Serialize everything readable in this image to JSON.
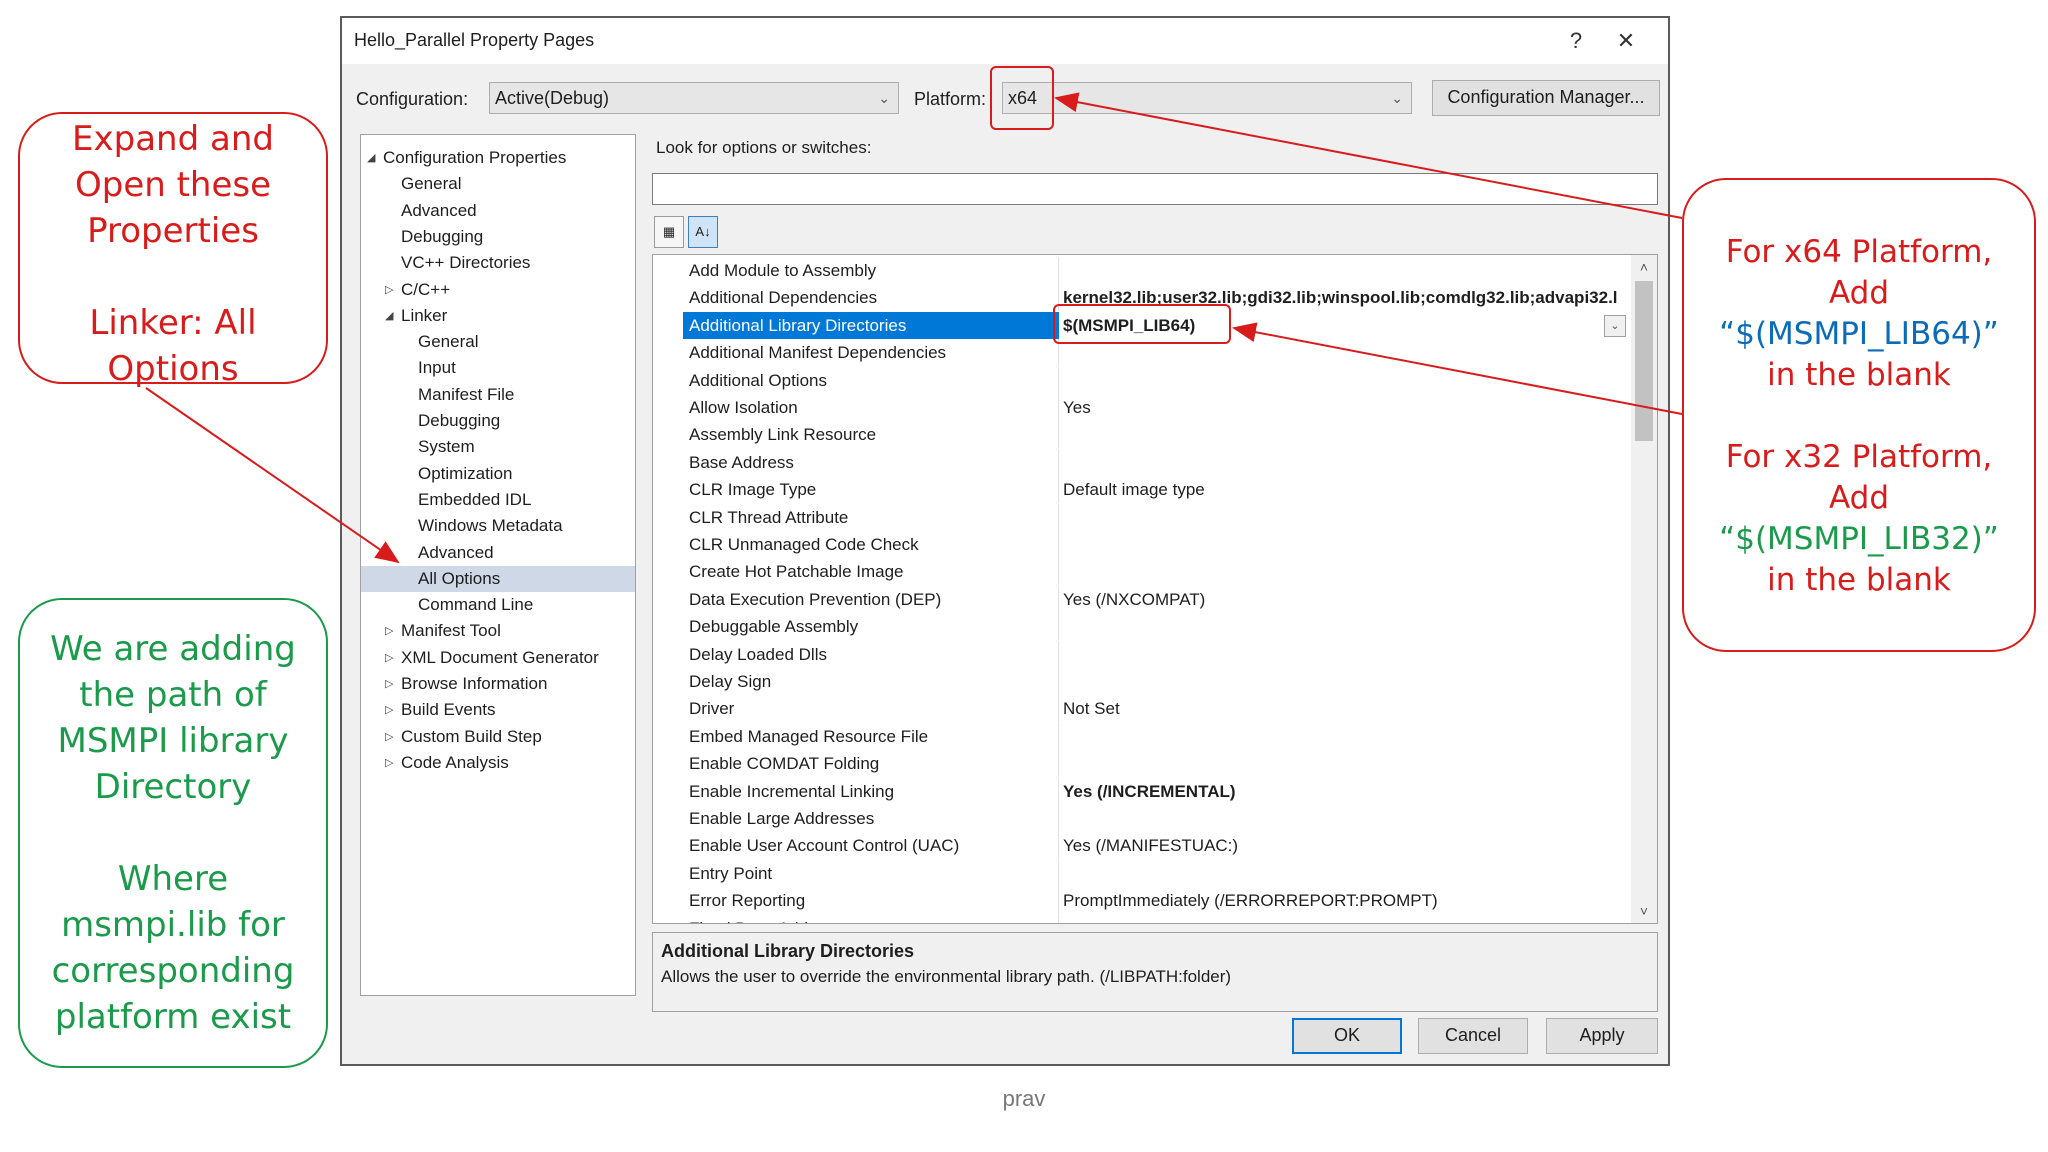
{
  "dialog": {
    "title": "Hello_Parallel Property Pages",
    "help_glyph": "?",
    "close_glyph": "✕",
    "configuration_label": "Configuration:",
    "configuration_value": "Active(Debug)",
    "platform_label": "Platform:",
    "platform_value": "x64",
    "configuration_manager_label": "Configuration Manager...",
    "search_label": "Look for options or switches:",
    "search_value": ""
  },
  "tree": [
    {
      "label": "Configuration Properties",
      "level": 0,
      "expander": "expanded"
    },
    {
      "label": "General",
      "level": 1,
      "expander": "none"
    },
    {
      "label": "Advanced",
      "level": 1,
      "expander": "none"
    },
    {
      "label": "Debugging",
      "level": 1,
      "expander": "none"
    },
    {
      "label": "VC++ Directories",
      "level": 1,
      "expander": "none"
    },
    {
      "label": "C/C++",
      "level": 1,
      "expander": "collapsed"
    },
    {
      "label": "Linker",
      "level": 1,
      "expander": "expanded"
    },
    {
      "label": "General",
      "level": 2,
      "expander": "none"
    },
    {
      "label": "Input",
      "level": 2,
      "expander": "none"
    },
    {
      "label": "Manifest File",
      "level": 2,
      "expander": "none"
    },
    {
      "label": "Debugging",
      "level": 2,
      "expander": "none"
    },
    {
      "label": "System",
      "level": 2,
      "expander": "none"
    },
    {
      "label": "Optimization",
      "level": 2,
      "expander": "none"
    },
    {
      "label": "Embedded IDL",
      "level": 2,
      "expander": "none"
    },
    {
      "label": "Windows Metadata",
      "level": 2,
      "expander": "none"
    },
    {
      "label": "Advanced",
      "level": 2,
      "expander": "none"
    },
    {
      "label": "All Options",
      "level": 2,
      "expander": "none",
      "selected": true
    },
    {
      "label": "Command Line",
      "level": 2,
      "expander": "none"
    },
    {
      "label": "Manifest Tool",
      "level": 1,
      "expander": "collapsed"
    },
    {
      "label": "XML Document Generator",
      "level": 1,
      "expander": "collapsed"
    },
    {
      "label": "Browse Information",
      "level": 1,
      "expander": "collapsed"
    },
    {
      "label": "Build Events",
      "level": 1,
      "expander": "collapsed"
    },
    {
      "label": "Custom Build Step",
      "level": 1,
      "expander": "collapsed"
    },
    {
      "label": "Code Analysis",
      "level": 1,
      "expander": "collapsed"
    }
  ],
  "grid": [
    {
      "name": "Add Module to Assembly",
      "value": ""
    },
    {
      "name": "Additional Dependencies",
      "value": "kernel32.lib;user32.lib;gdi32.lib;winspool.lib;comdlg32.lib;advapi32.l",
      "bold": true
    },
    {
      "name": "Additional Library Directories",
      "value": "$(MSMPI_LIB64)",
      "bold": true,
      "selected": true
    },
    {
      "name": "Additional Manifest Dependencies",
      "value": ""
    },
    {
      "name": "Additional Options",
      "value": ""
    },
    {
      "name": "Allow Isolation",
      "value": "Yes"
    },
    {
      "name": "Assembly Link Resource",
      "value": ""
    },
    {
      "name": "Base Address",
      "value": ""
    },
    {
      "name": "CLR Image Type",
      "value": "Default image type"
    },
    {
      "name": "CLR Thread Attribute",
      "value": ""
    },
    {
      "name": "CLR Unmanaged Code Check",
      "value": ""
    },
    {
      "name": "Create Hot Patchable Image",
      "value": ""
    },
    {
      "name": "Data Execution Prevention (DEP)",
      "value": "Yes (/NXCOMPAT)"
    },
    {
      "name": "Debuggable Assembly",
      "value": ""
    },
    {
      "name": "Delay Loaded Dlls",
      "value": ""
    },
    {
      "name": "Delay Sign",
      "value": ""
    },
    {
      "name": "Driver",
      "value": "Not Set"
    },
    {
      "name": "Embed Managed Resource File",
      "value": ""
    },
    {
      "name": "Enable COMDAT Folding",
      "value": ""
    },
    {
      "name": "Enable Incremental Linking",
      "value": "Yes (/INCREMENTAL)",
      "bold": true
    },
    {
      "name": "Enable Large Addresses",
      "value": ""
    },
    {
      "name": "Enable User Account Control (UAC)",
      "value": "Yes (/MANIFESTUAC:)"
    },
    {
      "name": "Entry Point",
      "value": ""
    },
    {
      "name": "Error Reporting",
      "value": "PromptImmediately (/ERRORREPORT:PROMPT)"
    },
    {
      "name": "Fixed Base Address",
      "value": ""
    }
  ],
  "description": {
    "title": "Additional Library Directories",
    "text": "Allows the user to override the environmental library path. (/LIBPATH:folder)"
  },
  "buttons": {
    "ok": "OK",
    "cancel": "Cancel",
    "apply": "Apply"
  },
  "callouts": {
    "expand": [
      "Expand and",
      "Open these",
      "Properties",
      "",
      "Linker: All",
      "Options"
    ],
    "adding": [
      "We are adding",
      "the path of",
      "MSMPI library",
      "Directory",
      "",
      "Where",
      "msmpi.lib for",
      "corresponding",
      "platform exist"
    ],
    "platform_x64": [
      "For x64 Platform,",
      "Add",
      "“$(MSMPI_LIB64)”",
      "in the blank"
    ],
    "platform_x32": [
      "For x32 Platform,",
      "Add",
      "“$(MSMPI_LIB32)”",
      "in the blank"
    ]
  },
  "footer": "prav",
  "colors": {
    "annotation_red": "#d81b1b",
    "annotation_green": "#1a9a4a",
    "annotation_blue": "#0a6cb8",
    "selection_blue": "#0078d7"
  },
  "icons": {
    "categorized": "categorized-icon",
    "alphabetical": "sort-alpha-icon"
  }
}
